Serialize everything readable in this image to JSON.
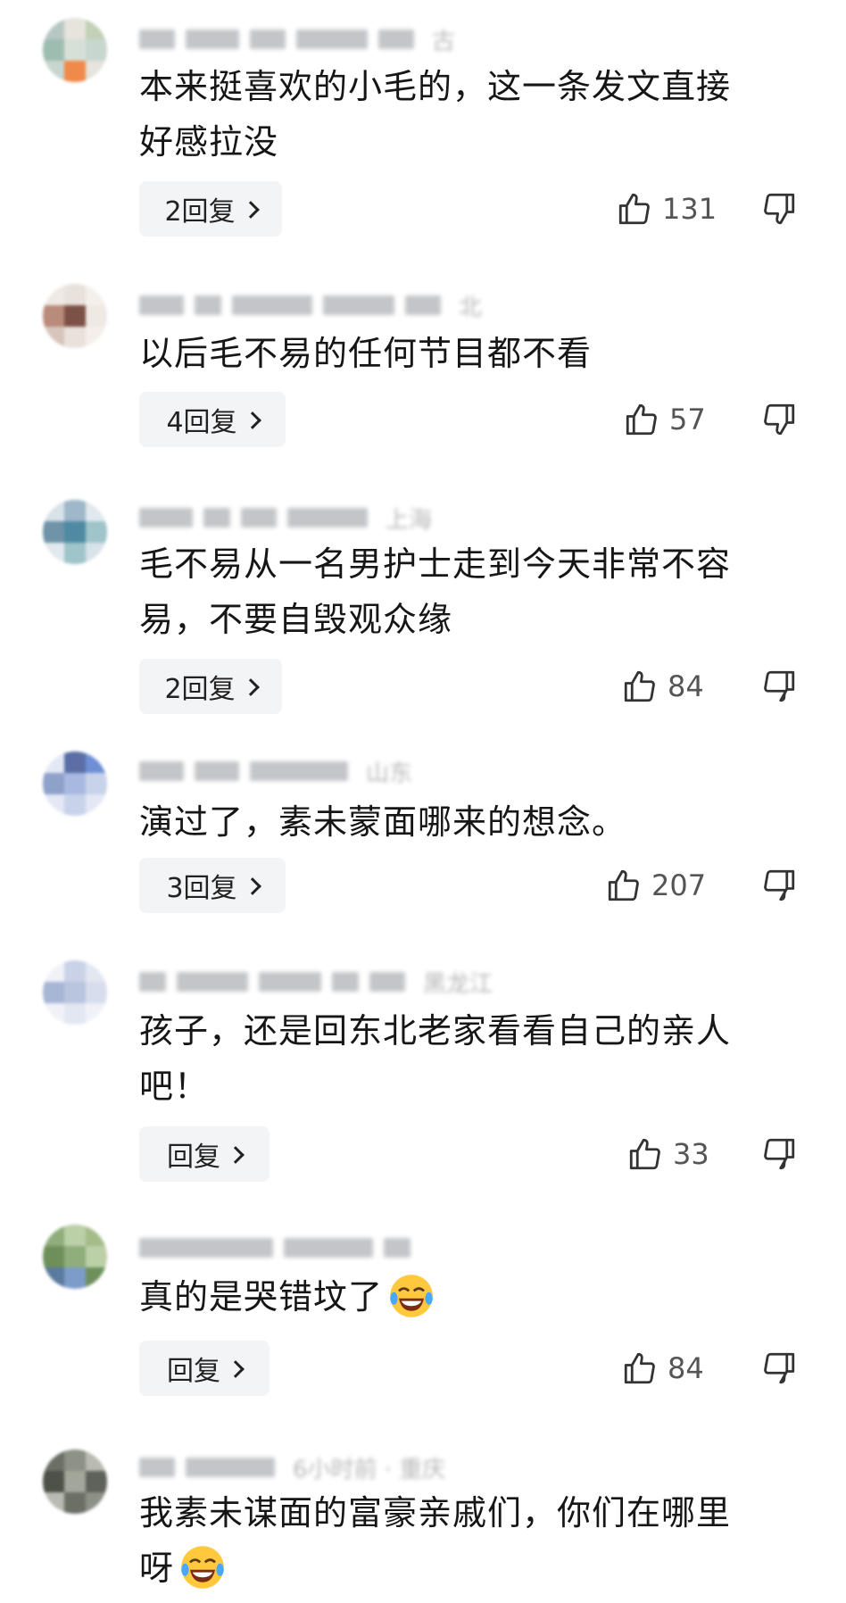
{
  "comments": [
    {
      "text_lines": [
        "本来挺喜欢的小毛的，这一条发文直接",
        "好感拉没"
      ],
      "meta_location": "古",
      "reply_label": "2回复",
      "like_count": "131",
      "avatar_colors": [
        "#b7c8c4",
        "#e6e4dc",
        "#c3d1b8",
        "#9ebdb1",
        "#f08a4b",
        "#c7d6cf"
      ]
    },
    {
      "text_lines": [
        "以后毛不易的任何节目都不看"
      ],
      "meta_location": "北",
      "reply_label": "4回复",
      "like_count": "57",
      "avatar_colors": [
        "#e9e2dc",
        "#b98b7a",
        "#efe9e4",
        "#d7c5bc",
        "#7c5146",
        "#f4efea"
      ]
    },
    {
      "text_lines": [
        "毛不易从一名男护士走到今天非常不容",
        "易，不要自毁观众缘"
      ],
      "meta_location": "上海",
      "reply_label": "2回复",
      "like_count": "84",
      "avatar_colors": [
        "#9eb7c9",
        "#6f93a8",
        "#d7e2e9",
        "#4f8aa3",
        "#9fc4c9",
        "#e1e9ee"
      ]
    },
    {
      "text_lines": [
        "演过了，素未蒙面哪来的想念。"
      ],
      "meta_location": "山东",
      "reply_label": "3回复",
      "like_count": "207",
      "avatar_colors": [
        "#8ea1c9",
        "#5b6fa6",
        "#c8d3ea",
        "#6f8fd4",
        "#a8b9e1",
        "#e3e8f4"
      ]
    },
    {
      "text_lines": [
        "孩子，还是回东北老家看看自己的亲人",
        "吧！"
      ],
      "meta_location": "黑龙江",
      "reply_label": "回复",
      "like_count": "33",
      "avatar_colors": [
        "#c9d2e6",
        "#a8b6d6",
        "#e2e7f2",
        "#b9c4de",
        "#d7dded",
        "#f0f2f8"
      ]
    },
    {
      "text_lines": [
        "真的是哭错坟了"
      ],
      "meta_location": "",
      "reply_label": "回复",
      "like_count": "84",
      "emoji": "laugh-cry-emoji",
      "avatar_colors": [
        "#8fae7c",
        "#bcd0a8",
        "#6e8f5a",
        "#5a7a9e",
        "#7d9cc9",
        "#a5bb88"
      ]
    },
    {
      "text_lines": [
        "我素未谋面的富豪亲戚们，你们在哪里",
        "呀"
      ],
      "meta_location": "6小时前 · 重庆",
      "reply_label": "",
      "like_count": "",
      "emoji": "laugh-cry-emoji",
      "avatar_colors": [
        "#6b6f66",
        "#8e9186",
        "#4d5148",
        "#a3a69a",
        "#5e6259",
        "#b9bbb0"
      ]
    }
  ],
  "icons": {
    "like": "thumbs-up-icon",
    "dislike": "thumbs-down-icon",
    "chevron": "chevron-right-icon"
  }
}
